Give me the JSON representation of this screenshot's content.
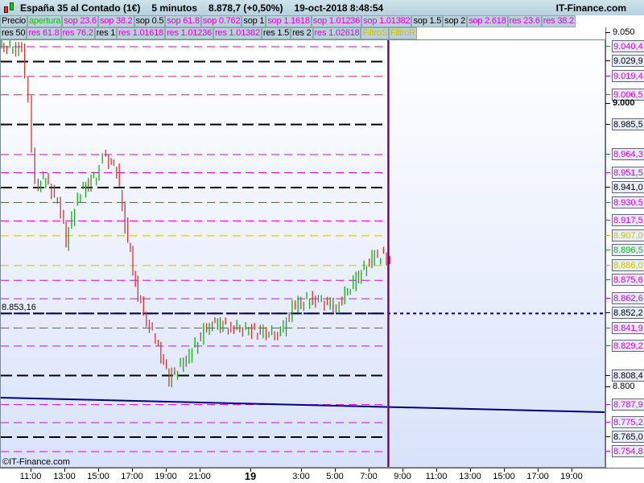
{
  "title": {
    "instrument": "España 35 al Contado (1€)",
    "timeframe": "5 minutos",
    "price": "8.878,7 (+0,50%)",
    "datetime": "19-oct-2018 8:48:54",
    "site": "IT-Finance.com"
  },
  "row1": [
    {
      "l": "Precio",
      "c": "k"
    },
    {
      "l": "apertura",
      "c": "g"
    },
    {
      "l": "sop 23.6",
      "c": "m"
    },
    {
      "l": "sop 38.2",
      "c": "m"
    },
    {
      "l": "sop 0.5",
      "c": "k"
    },
    {
      "l": "sop 61.8",
      "c": "m"
    },
    {
      "l": "sop 0.762",
      "c": "m"
    },
    {
      "l": "sop 1",
      "c": "k"
    },
    {
      "l": "sop 1.1618",
      "c": "m"
    },
    {
      "l": "sop 1.01236",
      "c": "m"
    },
    {
      "l": "sop 1.01382",
      "c": "m"
    },
    {
      "l": "sop 1.5",
      "c": "k"
    },
    {
      "l": "sop 2",
      "c": "k"
    },
    {
      "l": "sop 2.618",
      "c": "m"
    },
    {
      "l": "res 23.6",
      "c": "m"
    },
    {
      "l": "res 38.2",
      "c": "m"
    }
  ],
  "row2": [
    {
      "l": "res 50",
      "c": "k"
    },
    {
      "l": "res 61.8",
      "c": "m"
    },
    {
      "l": "res 76.2",
      "c": "m"
    },
    {
      "l": "res 1",
      "c": "k"
    },
    {
      "l": "res 1.01618",
      "c": "m"
    },
    {
      "l": "res 1.01236",
      "c": "m"
    },
    {
      "l": "res 1.01382",
      "c": "m"
    },
    {
      "l": "res 1.5",
      "c": "k"
    },
    {
      "l": "res 2",
      "c": "k"
    },
    {
      "l": "res 1.02618",
      "c": "m"
    },
    {
      "l": "FiltroS",
      "c": "y"
    },
    {
      "l": "FiltroR",
      "c": "y"
    }
  ],
  "colors": {
    "m": "#e000e0",
    "k": "#000000",
    "g": "#10c010",
    "y": "#d0c000",
    "b": "#000080",
    "up": "#10b010",
    "down": "#e03030"
  },
  "price_labels": [
    {
      "v": 9050,
      "t": "9.050",
      "c": "k",
      "box": false
    },
    {
      "v": 9040.4,
      "t": "9.040,4",
      "c": "m",
      "box": true
    },
    {
      "v": 9029.9,
      "t": "9.029,9",
      "c": "k",
      "box": true
    },
    {
      "v": 9019.4,
      "t": "9.019,4",
      "c": "m",
      "box": true
    },
    {
      "v": 9006.5,
      "t": "9.006,5",
      "c": "m",
      "box": true
    },
    {
      "v": 9000,
      "t": "9.000",
      "c": "k",
      "box": false,
      "bold": true
    },
    {
      "v": 8985.5,
      "t": "8.985,5",
      "c": "k",
      "box": true
    },
    {
      "v": 8964.3,
      "t": "8.964,3",
      "c": "m",
      "box": true
    },
    {
      "v": 8951.5,
      "t": "8.951,5",
      "c": "m",
      "box": true
    },
    {
      "v": 8941.0,
      "t": "8.941,0",
      "c": "k",
      "box": true
    },
    {
      "v": 8930.5,
      "t": "8.930,5",
      "c": "m",
      "box": true
    },
    {
      "v": 8917.5,
      "t": "8.917,5",
      "c": "m",
      "box": true
    },
    {
      "v": 8907.0,
      "t": "8.907,0",
      "c": "y",
      "box": true
    },
    {
      "v": 8896.5,
      "t": "8.896,5",
      "c": "g",
      "box": true
    },
    {
      "v": 8886.0,
      "t": "8.886,0",
      "c": "y",
      "box": true
    },
    {
      "v": 8875.6,
      "t": "8.875,6",
      "c": "m",
      "box": true
    },
    {
      "v": 8862.6,
      "t": "8.862,6",
      "c": "m",
      "box": true
    },
    {
      "v": 8852.2,
      "t": "8.852,2",
      "c": "k",
      "box": true
    },
    {
      "v": 8841.9,
      "t": "8.841,9",
      "c": "m",
      "box": true
    },
    {
      "v": 8829.2,
      "t": "8.829,2",
      "c": "m",
      "box": true
    },
    {
      "v": 8808.4,
      "t": "8.808,4",
      "c": "k",
      "box": true
    },
    {
      "v": 8800,
      "t": "8.800",
      "c": "k",
      "box": false
    },
    {
      "v": 8787.9,
      "t": "8.787,9",
      "c": "m",
      "box": true
    },
    {
      "v": 8775.2,
      "t": "8.775,2",
      "c": "m",
      "box": true
    },
    {
      "v": 8765.0,
      "t": "8.765,0",
      "c": "k",
      "box": true
    },
    {
      "v": 8754.8,
      "t": "8.754,8",
      "c": "m",
      "box": true
    }
  ],
  "time_labels": [
    {
      "h": 11,
      "t": "11:00"
    },
    {
      "h": 13,
      "t": "13:00"
    },
    {
      "h": 15,
      "t": "15:00"
    },
    {
      "h": 17,
      "t": "17:00"
    },
    {
      "h": 19,
      "t": "19:00"
    },
    {
      "h": 21,
      "t": "21:00"
    },
    {
      "h": 24,
      "t": "19",
      "bold": true
    },
    {
      "h": 27,
      "t": "3:00"
    },
    {
      "h": 29,
      "t": "5:00"
    },
    {
      "h": 31,
      "t": "7:00"
    },
    {
      "h": 33,
      "t": "9:00"
    },
    {
      "h": 35,
      "t": "11:00"
    },
    {
      "h": 37,
      "t": "13:00"
    },
    {
      "h": 39,
      "t": "15:00"
    },
    {
      "h": 41,
      "t": "17:00"
    },
    {
      "h": 43,
      "t": "19:00"
    }
  ],
  "last_close_label": "8.853,16",
  "last_close": 8852.2,
  "copyright": "©IT-Finance.com",
  "chart_data": {
    "type": "line",
    "xunit": "hours since 18-oct 00:00",
    "series": [
      [
        9.2,
        9041
      ],
      [
        10.6,
        9038
      ],
      [
        11,
        9000
      ],
      [
        11.4,
        8942
      ],
      [
        12,
        8948
      ],
      [
        12.9,
        8925
      ],
      [
        13.2,
        8902
      ],
      [
        13.9,
        8936
      ],
      [
        15,
        8950
      ],
      [
        15.4,
        8965
      ],
      [
        16.2,
        8953
      ],
      [
        16.7,
        8914
      ],
      [
        17.3,
        8874
      ],
      [
        17.8,
        8851
      ],
      [
        18.5,
        8834
      ],
      [
        19.3,
        8806
      ],
      [
        20.5,
        8823
      ],
      [
        21.7,
        8846
      ],
      [
        22.8,
        8843
      ],
      [
        24.2,
        8840
      ],
      [
        25.9,
        8837
      ],
      [
        26.6,
        8857
      ],
      [
        27.8,
        8863
      ],
      [
        29.2,
        8857
      ],
      [
        30.2,
        8874
      ],
      [
        31.3,
        8891
      ],
      [
        32,
        8894
      ],
      [
        32.4,
        8885
      ]
    ]
  }
}
